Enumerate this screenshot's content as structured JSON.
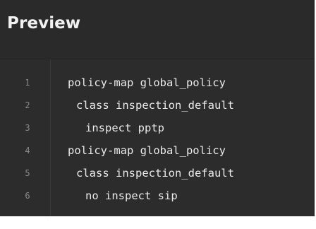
{
  "preview": {
    "title": "Preview",
    "lines": [
      {
        "number": "1",
        "text": "policy-map global_policy"
      },
      {
        "number": "2",
        "text": "class inspection_default"
      },
      {
        "number": "3",
        "text": "inspect pptp"
      },
      {
        "number": "4",
        "text": "policy-map global_policy"
      },
      {
        "number": "5",
        "text": "class inspection_default"
      },
      {
        "number": "6",
        "text": "no inspect sip"
      }
    ]
  }
}
